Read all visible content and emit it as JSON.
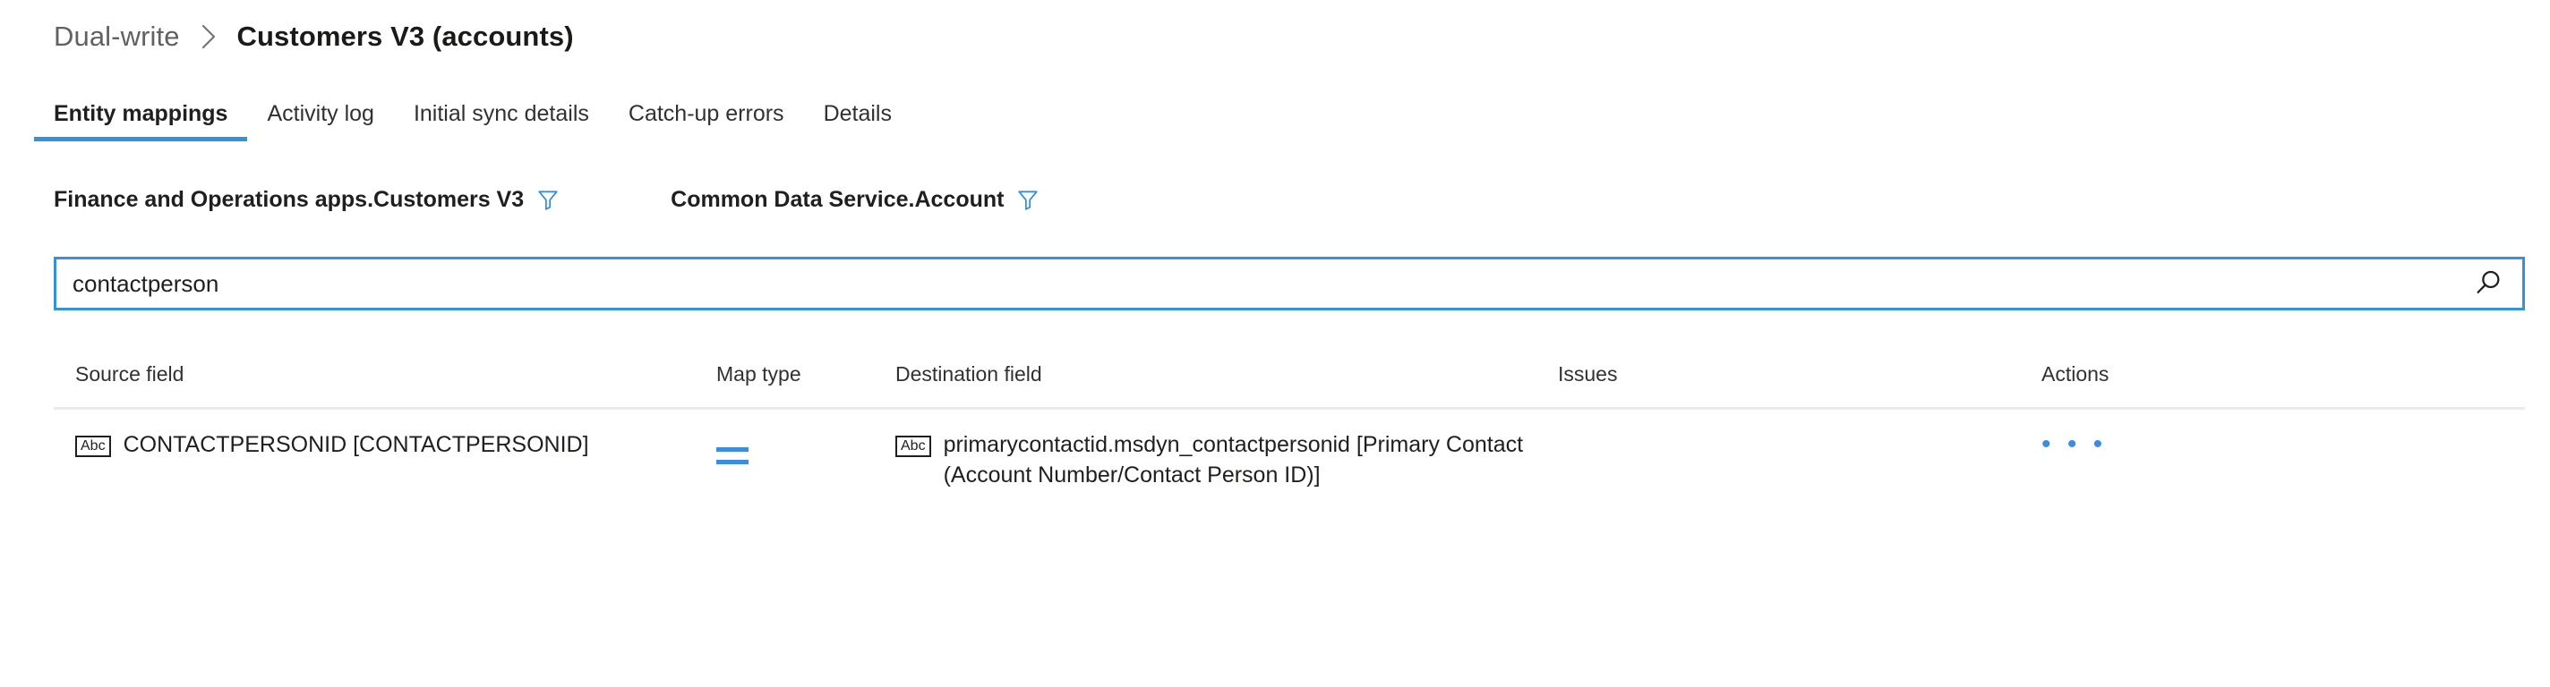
{
  "breadcrumb": {
    "parent": "Dual-write",
    "separator_icon": "chevron-right-icon",
    "current": "Customers V3 (accounts)"
  },
  "tabs": [
    {
      "label": "Entity mappings",
      "active": true
    },
    {
      "label": "Activity log",
      "active": false
    },
    {
      "label": "Initial sync details",
      "active": false
    },
    {
      "label": "Catch-up errors",
      "active": false
    },
    {
      "label": "Details",
      "active": false
    }
  ],
  "entity_mappings": {
    "source_entity": "Finance and Operations apps.Customers V3",
    "destination_entity": "Common Data Service.Account",
    "filter_icon": "filter-funnel-icon"
  },
  "search": {
    "value": "contactperson",
    "placeholder": "Search",
    "icon": "search-icon"
  },
  "table": {
    "columns": {
      "source_field": "Source field",
      "map_type": "Map type",
      "destination_field": "Destination field",
      "issues": "Issues",
      "actions": "Actions"
    },
    "rows": [
      {
        "source_field_icon": "abc-text-type-icon",
        "source_field_icon_label": "Abc",
        "source_field": "CONTACTPERSONID [CONTACTPERSONID]",
        "map_type_icon": "equals-icon",
        "destination_field_icon": "abc-text-type-icon",
        "destination_field_icon_label": "Abc",
        "destination_field": "primarycontactid.msdyn_contactpersonid [Primary Contact (Account Number/Contact Person ID)]",
        "issues": "",
        "actions_label": "• • •",
        "actions_icon": "more-options-ellipsis-icon"
      }
    ]
  },
  "colors": {
    "accent_blue": "#3293d9",
    "icon_blue": "#3b8edf",
    "text_primary": "#201f1e",
    "text_secondary": "#616161",
    "divider": "#ebebeb"
  }
}
